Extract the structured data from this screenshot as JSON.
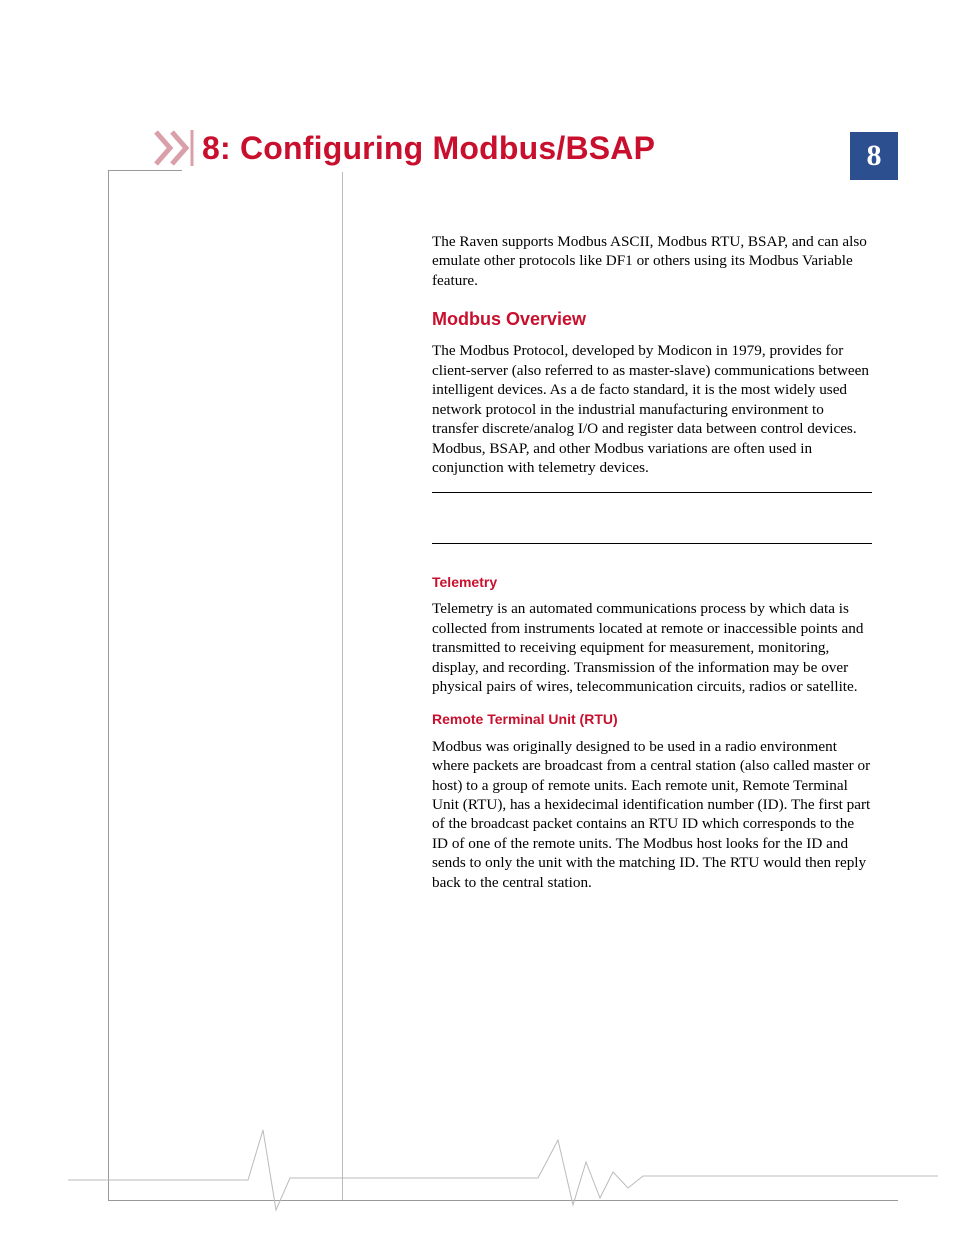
{
  "chapter": {
    "number": "8",
    "title": "8: Configuring Modbus/BSAP"
  },
  "intro": "The Raven supports Modbus ASCII, Modbus RTU, BSAP, and can also emulate other protocols like DF1 or others using its Modbus Variable feature.",
  "sections": {
    "overview": {
      "heading": "Modbus Overview",
      "body": "The Modbus Protocol, developed by Modicon in 1979, provides for client-server (also referred to as master-slave) communications between intelligent devices. As a de facto standard, it is the most widely used network protocol in the industrial manufacturing environment to transfer discrete/analog I/O and register data between control devices. Modbus, BSAP, and other Modbus variations are often used in conjunction with telemetry devices."
    },
    "telemetry": {
      "heading": "Telemetry",
      "body": "Telemetry is an automated communications process by which data is collected from instruments located at remote or inacces­sible points and transmitted to receiving equipment for measurement, monitoring, display, and recording. Trans­mission of the information may be over physical pairs of wires, telecommunication circuits, radios or satellite."
    },
    "rtu": {
      "heading": "Remote Terminal Unit (RTU)",
      "body": "Modbus was originally designed to be used in a radio environment where packets are broadcast from a central station (also called master or host) to a group of remote units. Each remote unit, Remote Terminal Unit (RTU), has a hexidecimal identification number (ID). The first part of the broadcast packet contains an RTU ID which corresponds to the ID of one of the remote units. The Modbus host looks for the ID and sends to only the unit with the matching ID. The RTU would then reply back to the central station."
    }
  }
}
